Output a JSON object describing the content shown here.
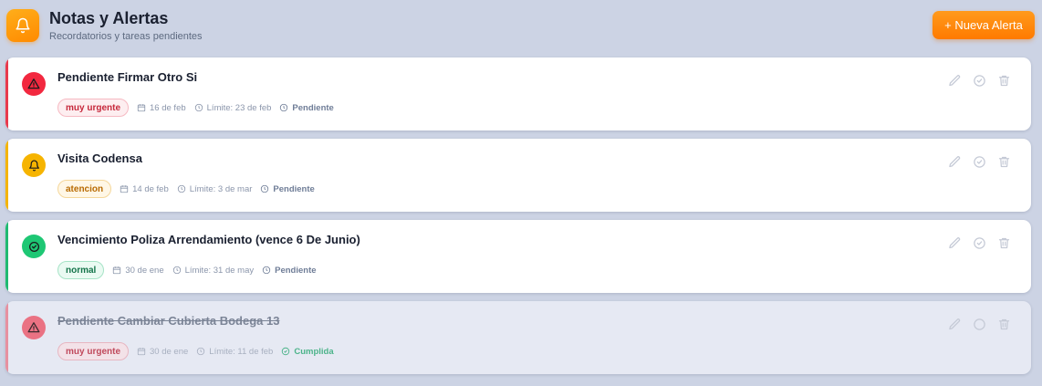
{
  "header": {
    "title": "Notas y Alertas",
    "subtitle": "Recordatorios y tareas pendientes",
    "new_button": "+ Nueva Alerta",
    "icon": "bell-icon"
  },
  "colors": {
    "urgent": "#e8394d",
    "attention": "#f4b400",
    "normal": "#1fba72",
    "accent": "#ff8a00"
  },
  "notes": [
    {
      "title": "Pendiente Firmar Otro Si",
      "priority": "muy urgente",
      "date": "16 de feb",
      "deadline": "Límite: 23 de feb",
      "status": "Pendiente",
      "icon": "warning-icon"
    },
    {
      "title": "Visita Codensa",
      "priority": "atencion",
      "date": "14 de feb",
      "deadline": "Límite: 3 de mar",
      "status": "Pendiente",
      "icon": "bell-icon"
    },
    {
      "title": "Vencimiento Poliza Arrendamiento (vence 6 De Junio)",
      "priority": "normal",
      "date": "30 de ene",
      "deadline": "Límite: 31 de may",
      "status": "Pendiente",
      "icon": "check-circle-icon"
    },
    {
      "title": "Pendiente Cambiar Cubierta Bodega 13",
      "priority": "muy urgente",
      "date": "30 de ene",
      "deadline": "Límite: 11 de feb",
      "status": "Cumplida",
      "icon": "warning-icon"
    }
  ]
}
